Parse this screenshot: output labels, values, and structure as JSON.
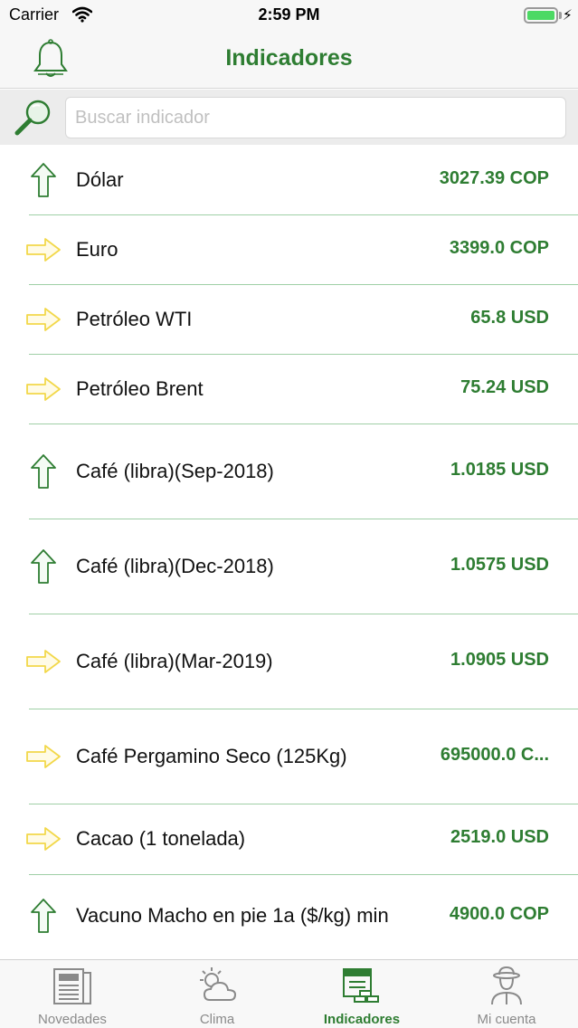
{
  "status": {
    "carrier": "Carrier",
    "time": "2:59 PM"
  },
  "nav": {
    "title": "Indicadores"
  },
  "search": {
    "placeholder": "Buscar indicador",
    "value": ""
  },
  "indicators": [
    {
      "name": "Dólar",
      "value": "3027.39 COP",
      "trend": "up"
    },
    {
      "name": "Euro",
      "value": "3399.0 COP",
      "trend": "flat"
    },
    {
      "name": "Petróleo WTI",
      "value": "65.8 USD",
      "trend": "flat"
    },
    {
      "name": "Petróleo Brent",
      "value": "75.24 USD",
      "trend": "flat"
    },
    {
      "name": "Café (libra)(Sep-2018)",
      "value": "1.0185 USD",
      "trend": "up"
    },
    {
      "name": "Café (libra)(Dec-2018)",
      "value": "1.0575 USD",
      "trend": "up"
    },
    {
      "name": "Café (libra)(Mar-2019)",
      "value": "1.0905 USD",
      "trend": "flat"
    },
    {
      "name": "Café Pergamino Seco (125Kg)",
      "value": "695000.0 C...",
      "trend": "flat"
    },
    {
      "name": "Cacao (1 tonelada)",
      "value": "2519.0 USD",
      "trend": "flat"
    },
    {
      "name": "Vacuno Macho en pie 1a ($/kg) min",
      "value": "4900.0 COP",
      "trend": "up"
    }
  ],
  "tabs": [
    {
      "label": "Novedades",
      "icon": "newspaper-icon",
      "active": false
    },
    {
      "label": "Clima",
      "icon": "weather-icon",
      "active": false
    },
    {
      "label": "Indicadores",
      "icon": "indicators-icon",
      "active": true
    },
    {
      "label": "Mi cuenta",
      "icon": "farmer-icon",
      "active": false
    }
  ],
  "colors": {
    "accent": "#2e7d32",
    "trend_up": "#2e7d32",
    "trend_flat": "#f2d84a",
    "separator": "#9fcfa6"
  }
}
